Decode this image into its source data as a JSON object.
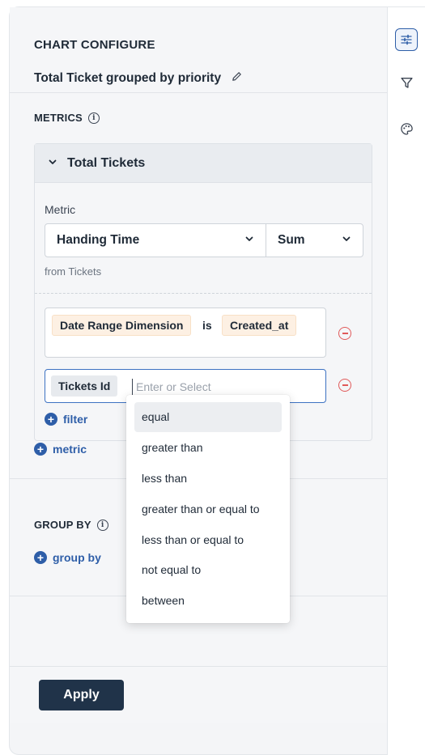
{
  "header": {
    "title": "CHART CONFIGURE",
    "chart_name": "Total Ticket grouped by priority"
  },
  "metrics": {
    "label": "METRICS",
    "card_title": "Total Tickets",
    "metric_label": "Metric",
    "field_value": "Handing Time",
    "aggregation_value": "Sum",
    "source_text": "from Tickets",
    "filter1": {
      "dimension": "Date Range Dimension",
      "operator": "is",
      "value": "Created_at"
    },
    "filter2": {
      "dimension": "Tickets Id",
      "placeholder": "Enter or Select"
    },
    "add_filter_label": "filter",
    "add_metric_label": "metric"
  },
  "group_by": {
    "label": "GROUP BY",
    "add_label": "group by"
  },
  "operator_menu": {
    "options": [
      "equal",
      "greater than",
      "less than",
      "greater than or equal to",
      "less than or equal to",
      "not equal to",
      "between"
    ],
    "highlighted": "equal"
  },
  "footer": {
    "apply_label": "Apply"
  },
  "sidebar_tools": [
    "sliders-icon",
    "filter-funnel-icon",
    "palette-icon"
  ],
  "colors": {
    "accent": "#2e5ea8",
    "apply_bg": "#203349",
    "remove": "#e05a5a",
    "chip_orange": "#fdf0e3"
  }
}
